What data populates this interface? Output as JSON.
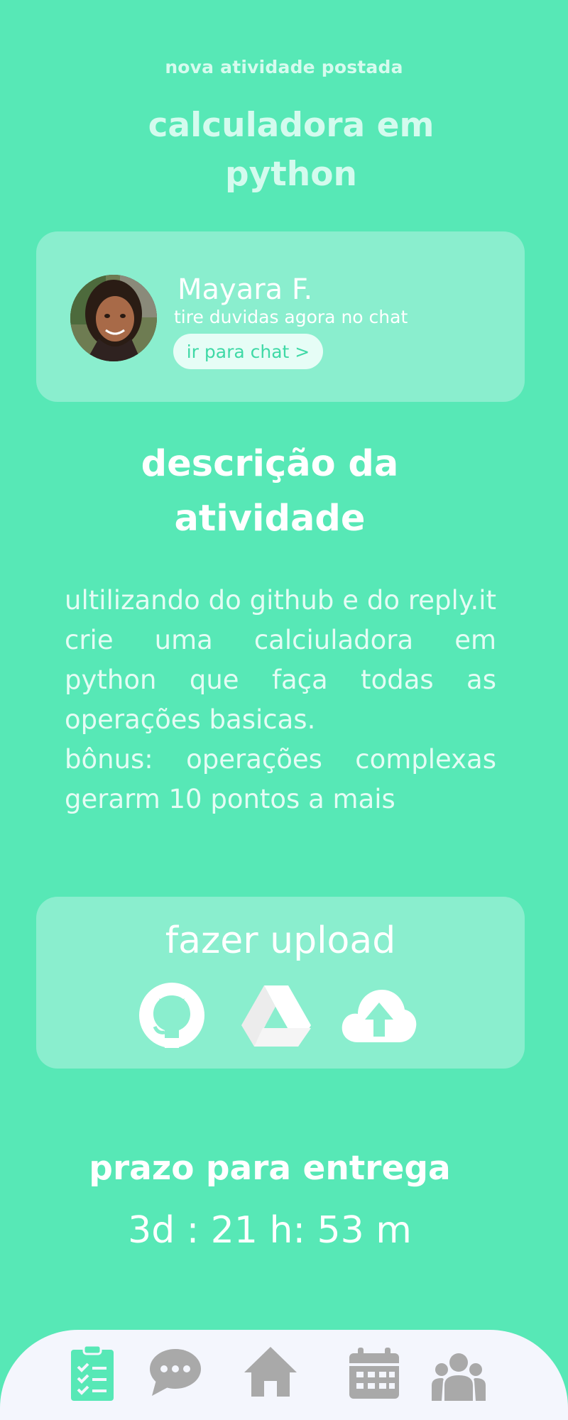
{
  "header": {
    "subtitle": "nova atividade postada",
    "title": "calculadora em python"
  },
  "teacher": {
    "name": "Mayara F.",
    "hint": "tire duvidas agora no chat",
    "chat_button": "ir para chat >"
  },
  "description": {
    "title": "descrição  da atividade",
    "lines": [
      "ultilizando do github e do reply.it crie uma calciuladora em python que faça todas as operações basicas.",
      "bônus: operações complexas gerarm 10 pontos a mais"
    ]
  },
  "upload": {
    "title": "fazer upload",
    "icons": [
      "github-icon",
      "google-drive-icon",
      "cloud-upload-icon"
    ]
  },
  "deadline": {
    "label": "prazo para entrega",
    "value": "3d : 21 h: 53 m"
  },
  "nav": {
    "items": [
      "tasks-icon",
      "chat-icon",
      "home-icon",
      "calendar-icon",
      "group-icon"
    ],
    "active": "tasks-icon"
  },
  "colors": {
    "background": "#57e8b6",
    "card": "#8aeece",
    "accent": "#3fd9a6",
    "nav_background": "#f4f6fd",
    "nav_active": "#57e8b6",
    "nav_inactive": "#a9a9a9"
  }
}
